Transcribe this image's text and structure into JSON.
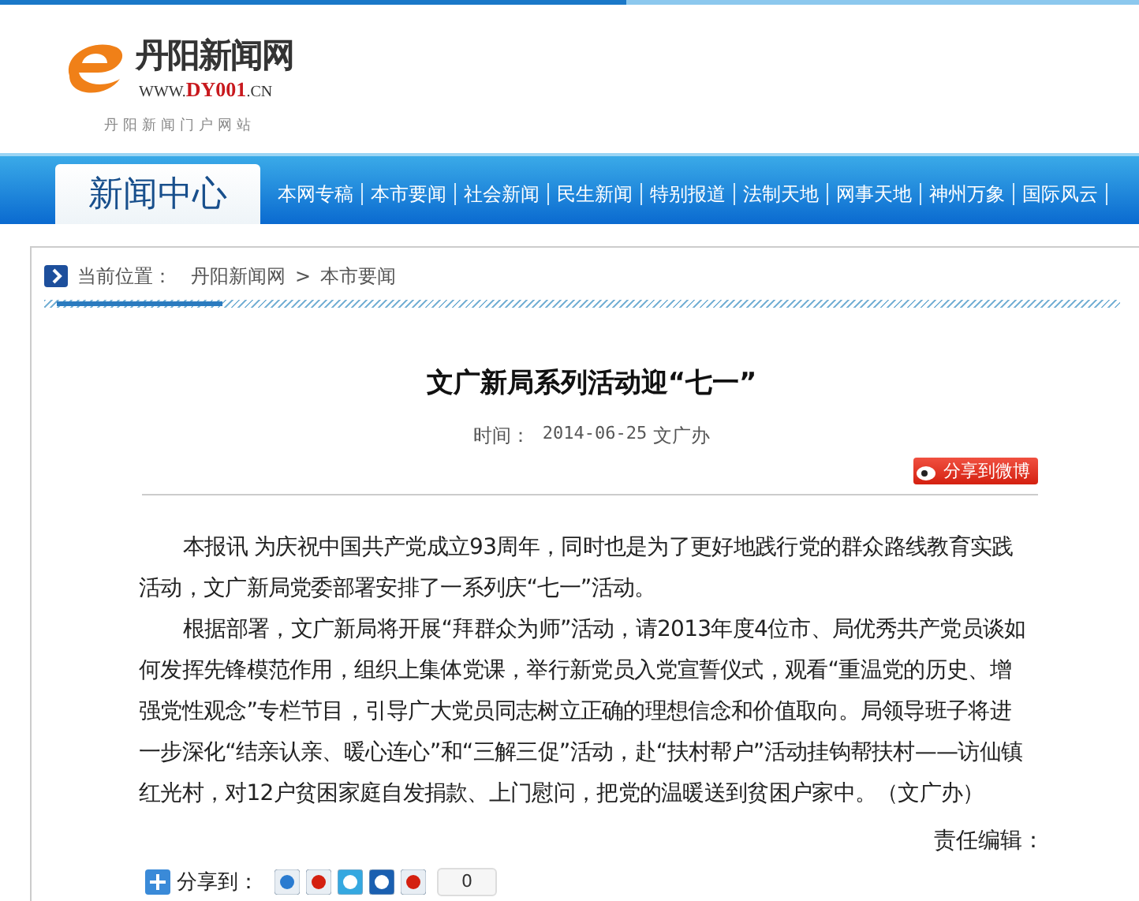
{
  "logo": {
    "name": "丹阳新闻网",
    "url_prefix": "WWW.",
    "url_main": "DY001",
    "url_suffix": ".CN",
    "slogan": "丹阳新闻门户网站"
  },
  "nav": {
    "title": "新闻中心",
    "items": [
      "本网专稿",
      "本市要闻",
      "社会新闻",
      "民生新闻",
      "特别报道",
      "法制天地",
      "网事天地",
      "神州万象",
      "国际风云"
    ]
  },
  "breadcrumb": {
    "label": "当前位置：",
    "items": [
      "丹阳新闻网",
      "本市要闻"
    ],
    "separator": ">"
  },
  "article": {
    "title": "文广新局系列活动迎“七一”",
    "meta_label": "时间：",
    "date": "2014-06-25",
    "source": "文广办",
    "weibo_share": "分享到微博",
    "paragraphs": [
      "本报讯  为庆祝中国共产党成立93周年，同时也是为了更好地践行党的群众路线教育实践活动，文广新局党委部署安排了一系列庆“七一”活动。",
      "根据部署，文广新局将开展“拜群众为师”活动，请2013年度4位市、局优秀共产党员谈如何发挥先锋模范作用，组织上集体党课，举行新党员入党宣誓仪式，观看“重温党的历史、增强党性观念”专栏节目，引导广大党员同志树立正确的理想信念和价值取向。局领导班子将进一步深化“结亲认亲、暖心连心”和“三解三促”活动，赴“扶村帮户”活动挂钩帮扶村——访仙镇红光村，对12户贫困家庭自发捐款、上门慰问，把党的温暖送到贫困户家中。（文广办）"
    ],
    "editor": "责任编辑：",
    "share": {
      "label": "分享到：",
      "count": "0"
    }
  }
}
